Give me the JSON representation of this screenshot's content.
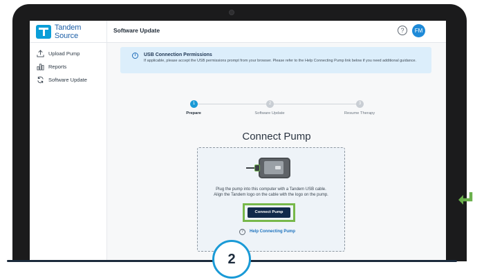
{
  "brand": {
    "name": "Tandem Source"
  },
  "header": {
    "title": "Software Update",
    "help_glyph": "?",
    "avatar_initials": "FM"
  },
  "sidebar": {
    "items": [
      {
        "label": "Upload Pump",
        "icon": "upload-icon"
      },
      {
        "label": "Reports",
        "icon": "bar-chart-icon"
      },
      {
        "label": "Software Update",
        "icon": "refresh-icon"
      }
    ]
  },
  "banner": {
    "icon_glyph": "i",
    "title": "USB Connection Permissions",
    "text": "If applicable, please accept the USB permissions prompt from your browser. Please refer to the Help Connecting Pump link below if you need additional guidance."
  },
  "stepper": {
    "steps": [
      {
        "number": "1",
        "label": "Prepare",
        "active": true
      },
      {
        "number": "2",
        "label": "Software Update",
        "active": false
      },
      {
        "number": "3",
        "label": "Resume Therapy",
        "active": false
      }
    ]
  },
  "main": {
    "heading": "Connect Pump",
    "instructions_line1": "Plug the pump into this computer with a Tandem USB cable.",
    "instructions_line2": "Align the Tandem logo on the cable with the logo on the pump.",
    "connect_button": "Connect Pump",
    "help_link": "Help Connecting Pump",
    "help_glyph": "?"
  },
  "overlay": {
    "step_badge": "2"
  },
  "colors": {
    "accent": "#1a9ad6",
    "highlight": "#77b84a",
    "button": "#11294a",
    "link": "#1e73be"
  }
}
